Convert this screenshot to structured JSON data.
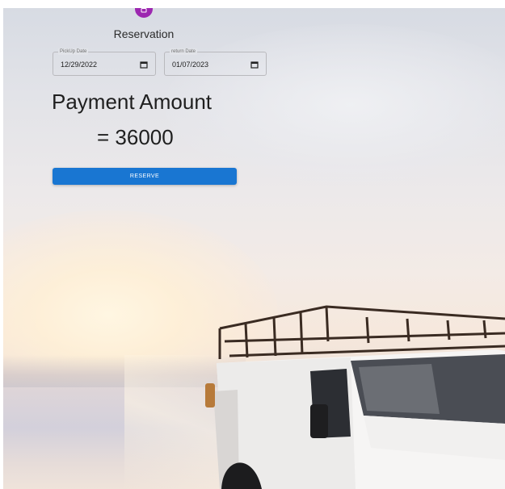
{
  "form": {
    "title": "Reservation",
    "pickup": {
      "label": "PickUp Date",
      "value": "12/29/2022"
    },
    "return": {
      "label": "return Date",
      "value": "01/07/2023"
    },
    "amount_label": "Payment Amount",
    "amount_value": "= 36000",
    "reserve_label": "RESERVE"
  },
  "colors": {
    "avatar": "#9c27b0",
    "button": "#1976d2"
  },
  "icons": {
    "avatar": "lock-icon",
    "date_picker": "calendar-icon"
  }
}
